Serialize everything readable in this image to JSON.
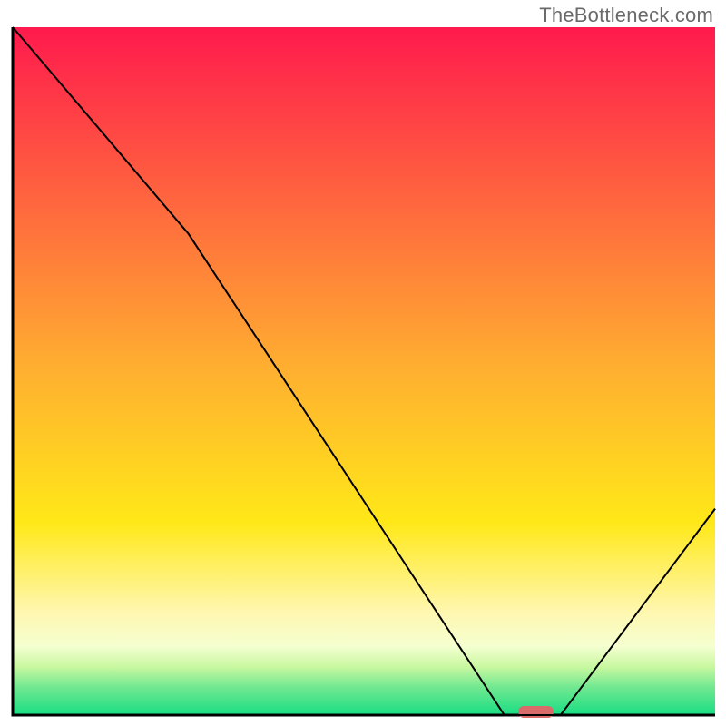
{
  "attribution": "TheBottleneck.com",
  "chart_data": {
    "type": "line",
    "title": "",
    "xlabel": "",
    "ylabel": "",
    "xlim": [
      0,
      100
    ],
    "ylim": [
      0,
      100
    ],
    "grid": false,
    "legend": false,
    "x": [
      0,
      25,
      70,
      75,
      78,
      100
    ],
    "values": [
      100,
      70,
      0,
      0,
      0,
      30
    ],
    "line_color": "#000000",
    "line_width": 2,
    "optimal_marker": {
      "x_start": 72,
      "x_end": 77,
      "color": "#d96b6b"
    },
    "background_gradient": [
      {
        "offset": 0.0,
        "color": "#ff1a4d"
      },
      {
        "offset": 0.5,
        "color": "#ffb030"
      },
      {
        "offset": 0.72,
        "color": "#ffe818"
      },
      {
        "offset": 0.85,
        "color": "#fff7b0"
      },
      {
        "offset": 0.9,
        "color": "#f5ffd0"
      },
      {
        "offset": 0.93,
        "color": "#c8f8a0"
      },
      {
        "offset": 0.96,
        "color": "#70e890"
      },
      {
        "offset": 1.0,
        "color": "#18dd83"
      }
    ],
    "axes_color": "#000000",
    "axes_width": 3
  }
}
